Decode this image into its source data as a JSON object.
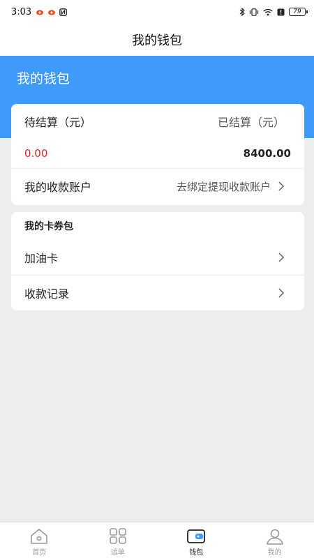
{
  "status_bar": {
    "time": "3:03",
    "battery": "79"
  },
  "nav": {
    "title": "我的钱包"
  },
  "header": {
    "title": "我的钱包"
  },
  "balance": {
    "pending_label": "待结算（元）",
    "settled_label": "已结算（元）",
    "pending_value": "0.00",
    "settled_value": "8400.00",
    "account_label": "我的收款账户",
    "account_hint": "去绑定提现收款账户"
  },
  "coupon": {
    "section_title": "我的卡券包",
    "items": [
      {
        "label": "加油卡"
      },
      {
        "label": "收款记录"
      }
    ]
  },
  "tabbar": {
    "tabs": [
      {
        "label": "首页",
        "icon": "home-icon"
      },
      {
        "label": "运单",
        "icon": "grid-icon"
      },
      {
        "label": "钱包",
        "icon": "wallet-icon",
        "active": true
      },
      {
        "label": "我的",
        "icon": "user-icon"
      }
    ]
  },
  "colors": {
    "accent": "#3E9BFA",
    "pending_value": "#D0282B",
    "background": "#EDEDED"
  }
}
